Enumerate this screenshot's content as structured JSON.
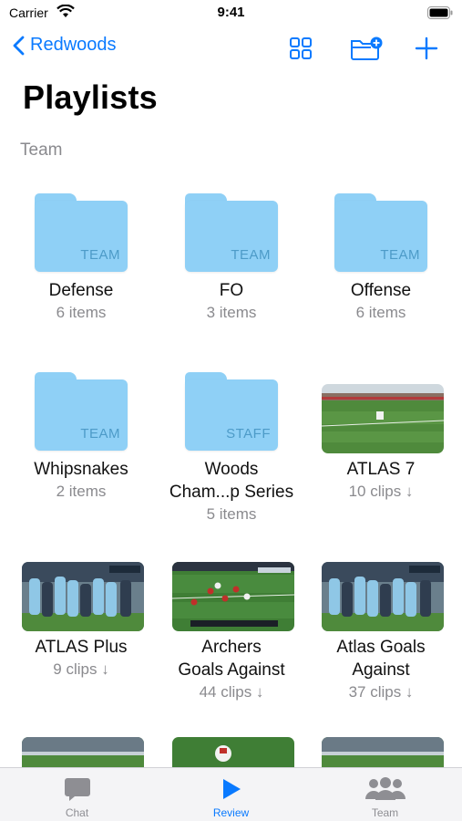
{
  "status_bar": {
    "carrier": "Carrier",
    "time": "9:41"
  },
  "navbar": {
    "back_label": "Redwoods"
  },
  "page": {
    "title": "Playlists",
    "section": "Team"
  },
  "colors": {
    "accent": "#0a7aff",
    "folder": "#8fd0f6",
    "secondary_text": "#8a8a8e",
    "field_green": "#4f8a3c"
  },
  "playlists": [
    {
      "kind": "folder",
      "badge": "TEAM",
      "title": "Defense",
      "subtitle": "6 items"
    },
    {
      "kind": "folder",
      "badge": "TEAM",
      "title": "FO",
      "subtitle": "3 items"
    },
    {
      "kind": "folder",
      "badge": "TEAM",
      "title": "Offense",
      "subtitle": "6 items"
    },
    {
      "kind": "folder",
      "badge": "TEAM",
      "title": "Whipsnakes",
      "subtitle": "2 items"
    },
    {
      "kind": "folder",
      "badge": "STAFF",
      "title": "Woods",
      "title2": "Cham...p Series",
      "subtitle": "5 items"
    },
    {
      "kind": "video",
      "title": "ATLAS 7",
      "subtitle": "10 clips ↓"
    },
    {
      "kind": "video",
      "title": "ATLAS Plus",
      "subtitle": "9 clips ↓"
    },
    {
      "kind": "video",
      "title": "Archers",
      "title2": "Goals Against",
      "subtitle": "44 clips ↓"
    },
    {
      "kind": "video",
      "title": "Atlas Goals",
      "title2": "Against",
      "subtitle": "37 clips ↓"
    }
  ],
  "tabbar": {
    "items": [
      {
        "label": "Chat"
      },
      {
        "label": "Review"
      },
      {
        "label": "Team"
      }
    ]
  }
}
